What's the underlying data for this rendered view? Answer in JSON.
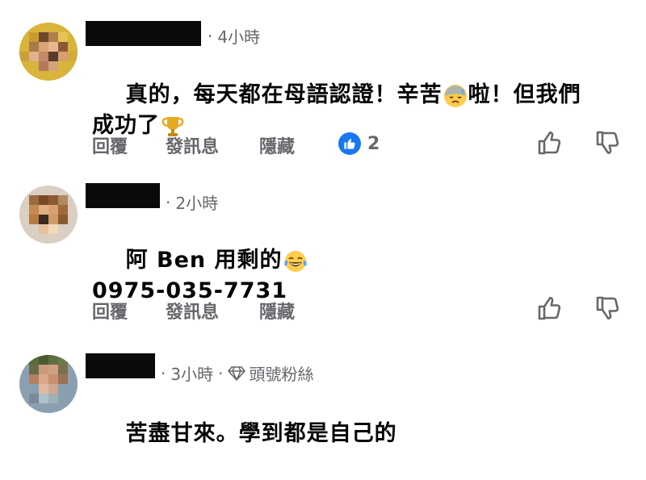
{
  "comments": [
    {
      "time": "4小時",
      "text_line1_a": "真的，每天都在母語認證！辛苦",
      "text_line1_b": "啦！但我們",
      "text_line2": "成功了",
      "emojis": [
        "downcast-sweat-face-emoji",
        "trophy-emoji"
      ],
      "actions": {
        "reply": "回覆",
        "message": "發訊息",
        "hide": "隱藏"
      },
      "like_count": "2"
    },
    {
      "time": "2小時",
      "text_line1": "阿 Ben 用剩的",
      "text_line2": "0975-035-7731",
      "emojis": [
        "laughing-tears-face-emoji"
      ],
      "actions": {
        "reply": "回覆",
        "message": "發訊息",
        "hide": "隱藏"
      }
    },
    {
      "time": "3小時",
      "badge": "頭號粉絲",
      "text_line1": "苦盡甘來。學到都是自己的"
    }
  ],
  "icons": {
    "like": "thumbs-up-icon",
    "dislike": "thumbs-down-icon",
    "top_fan": "diamond-icon",
    "reaction": "like-reaction-icon"
  },
  "colors": {
    "meta_gray": "#65676b",
    "like_blue": "#1877f2",
    "text": "#050505",
    "redaction": "#0a0a0a"
  }
}
